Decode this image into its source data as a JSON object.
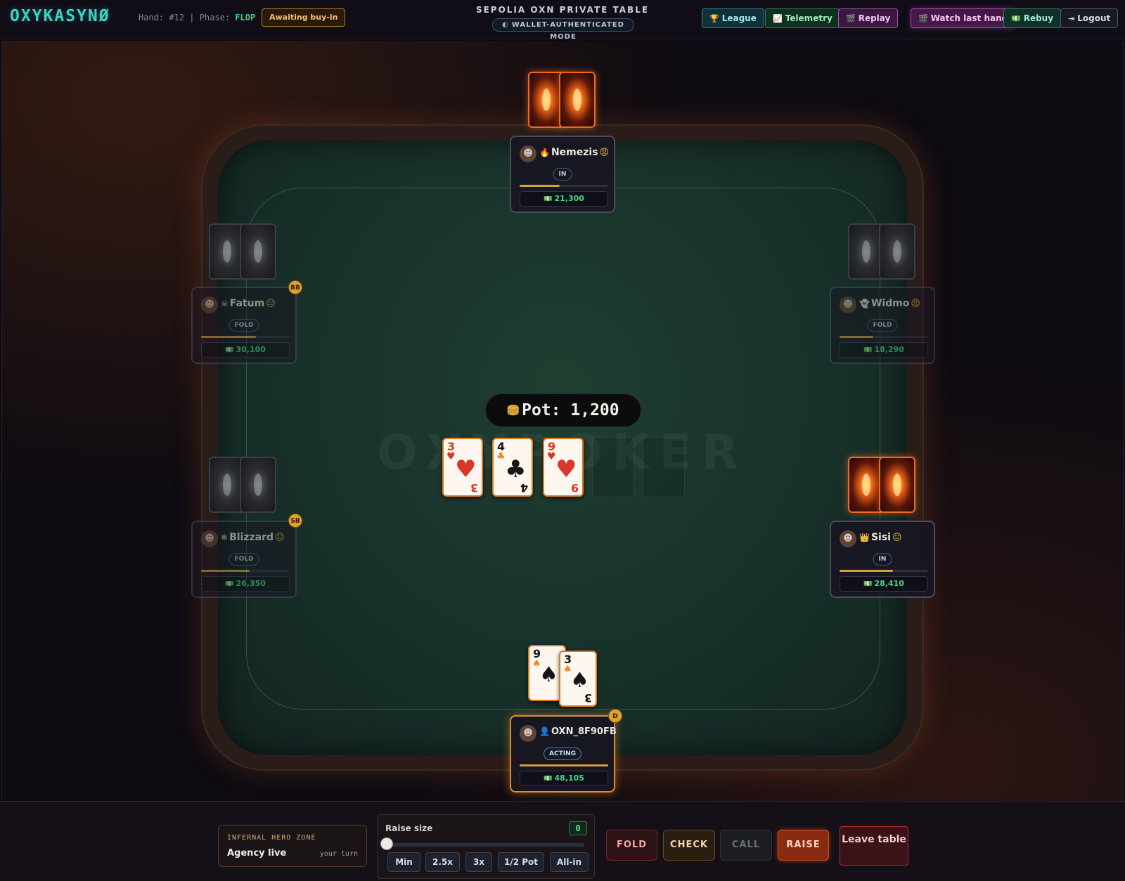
{
  "header": {
    "brand": "OXYKASYNØ",
    "hand_label": "Hand: #12 | Phase:",
    "phase": "FLOP",
    "status_chip": "Awaiting buy-in",
    "table_title": "SEPOLIA OXN PRIVATE TABLE",
    "mode_pill": "WALLET-AUTHENTICATED MODE",
    "nav": {
      "league": "League",
      "telemetry": "Telemetry",
      "replay": "Replay",
      "watch_last_hand": "Watch last hand",
      "rebuy": "Rebuy",
      "logout": "Logout"
    }
  },
  "table": {
    "watermark": "OXYPOKER",
    "pot": "Pot: 1,200",
    "board": [
      {
        "rank": "3",
        "suit": "♥",
        "color": "red"
      },
      {
        "rank": "4",
        "suit": "♣",
        "color": "black"
      },
      {
        "rank": "9",
        "suit": "♥",
        "color": "red"
      }
    ]
  },
  "players": {
    "nemezis": {
      "name": "Nemezis",
      "tag": "🔥",
      "mood": "😡",
      "state": "IN",
      "stack": "21,300",
      "stack_fraction": 0.45
    },
    "fatum": {
      "name": "Fatum",
      "tag": "☠",
      "mood": "😐",
      "state": "FOLD",
      "stack": "30,100",
      "badge": "BB",
      "stack_fraction": 0.62
    },
    "widmo": {
      "name": "Widmo",
      "tag": "👻",
      "mood": "😡",
      "state": "FOLD",
      "stack": "18,290",
      "stack_fraction": 0.38
    },
    "blizzard": {
      "name": "Blizzard",
      "tag": "❄",
      "mood": "😐",
      "state": "FOLD",
      "stack": "26,350",
      "badge": "SB",
      "stack_fraction": 0.55
    },
    "sisi": {
      "name": "Sisi",
      "tag": "👑",
      "mood": "😐",
      "state": "IN",
      "stack": "28,410",
      "stack_fraction": 0.6
    },
    "hero": {
      "name": "OXN_8F90FB",
      "tag": "👤",
      "state": "ACTING",
      "stack": "48,105",
      "badge": "D",
      "stack_fraction": 1.0,
      "cards": [
        {
          "rank": "9",
          "suit": "♠"
        },
        {
          "rank": "3",
          "suit": "♠"
        }
      ]
    }
  },
  "footer": {
    "hero_zone_title": "INFERNAL HERO ZONE",
    "hero_zone_main": "Agency live",
    "hero_zone_turn": "your turn",
    "raise_label": "Raise size",
    "raise_value": "0",
    "raise_fraction": 0,
    "presets": [
      "Min",
      "2.5x",
      "3x",
      "1/2 Pot",
      "All-in"
    ],
    "actions": {
      "fold": "FOLD",
      "check": "CHECK",
      "call": "CALL",
      "raise": "RAISE",
      "leave": "Leave table"
    }
  },
  "colors": {
    "accent_brand": "#3fd0c7",
    "hero_border": "#e68a2a",
    "stack_green": "#46d486",
    "felt": "#18302a"
  }
}
